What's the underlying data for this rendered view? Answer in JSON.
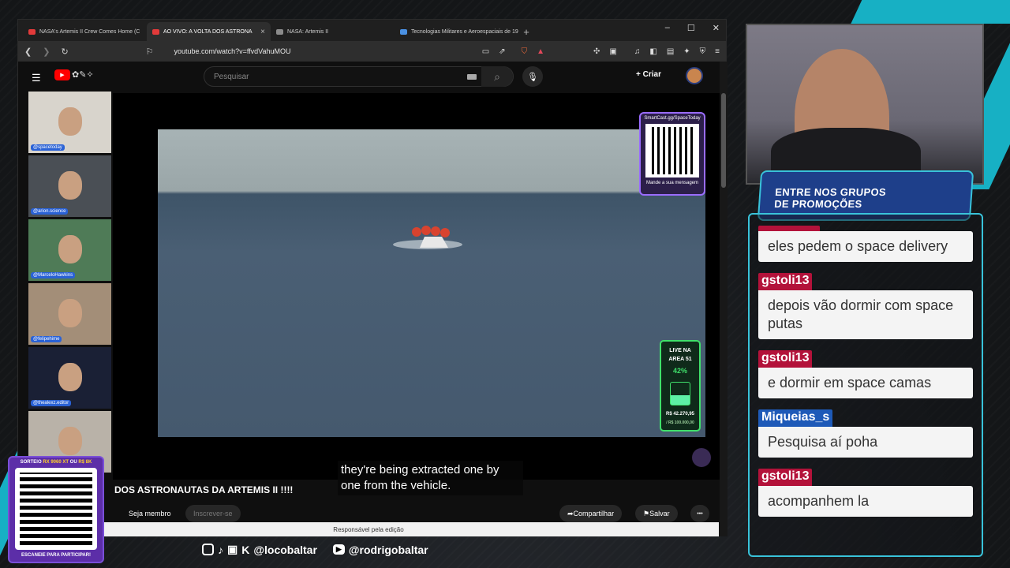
{
  "browser": {
    "tabs": [
      {
        "title": "NASA's Artemis II Crew Comes Home (C",
        "color": "#e23a3a",
        "active": false
      },
      {
        "title": "AO VIVO: A VOLTA DOS ASTRONA",
        "color": "#e23a3a",
        "active": true
      },
      {
        "title": "NASA: Artemis II",
        "color": "#8a8a8a",
        "active": false
      },
      {
        "title": "Tecnologias Militares e Aeroespaciais de 19",
        "color": "#4a90e2",
        "active": false
      }
    ],
    "url": "youtube.com/watch?v=ffvdVahuMOU",
    "new_tab": "+",
    "controls": [
      "–",
      "☐",
      "✕"
    ]
  },
  "youtube": {
    "search_placeholder": "Pesquisar",
    "create_label": "Criar",
    "video_title": "DOS ASTRONAUTAS DA ARTEMIS II !!!!",
    "subtitle": "they're being extracted one by one from the vehicle.",
    "buttons": {
      "member": "Seja membro",
      "subscribe": "Inscrever-se",
      "share": "Compartilhar",
      "save": "Salvar",
      "more": "•••"
    },
    "footer": "Responsável pela edição"
  },
  "overlay": {
    "qr_title": "SmartCast.gg/SpaceToday",
    "qr_caption": "Mande a sua mensagem",
    "live_title_1": "LIVE NA",
    "live_title_2": "AREA 51",
    "live_percent": "42%",
    "live_progress": 0.42,
    "live_amount": "R$ 42.270,95",
    "live_goal": "/ R$ 100.000,00"
  },
  "participants": [
    {
      "handle": "@spacetoday",
      "bg": "#d8d4cc"
    },
    {
      "handle": "@arion.science",
      "bg": "#4a4f55"
    },
    {
      "handle": "@MarceloHawkins",
      "bg": "#4f7b57"
    },
    {
      "handle": "@felipehime",
      "bg": "#a38e78"
    },
    {
      "handle": "@thealexz.editor",
      "bg": "#1a2035"
    },
    {
      "handle": "",
      "bg": "#b9b2a8"
    }
  ],
  "promo": {
    "line1": "ENTRE NOS GRUPOS",
    "line2": "DE PROMOÇÕES"
  },
  "chat": [
    {
      "user": "",
      "text": "eles pedem o space delivery",
      "color": "#b3123a"
    },
    {
      "user": "gstoli13",
      "text": "depois vão dormir com space putas",
      "color": "#b3123a"
    },
    {
      "user": "gstoli13",
      "text": "e dormir em space camas",
      "color": "#b3123a"
    },
    {
      "user": "Miqueias_s",
      "text": "Pesquisa aí poha",
      "color": "#1e5ab8"
    },
    {
      "user": "gstoli13",
      "text": "acompanhem la",
      "color": "#b3123a"
    }
  ],
  "sorteio": {
    "title_a": "SORTEIO ",
    "title_b": "RX 9060 XT",
    "title_c": " OU ",
    "title_d": "R$ 8K",
    "caption": "ESCANEIE PARA PARTICIPAR!"
  },
  "social": {
    "handle1": "@locobaltar",
    "handle2": "@rodrigobaltar"
  },
  "colors": {
    "accent": "#39c3da",
    "chat_name": "#b3123a",
    "live": "#3fe06a"
  }
}
